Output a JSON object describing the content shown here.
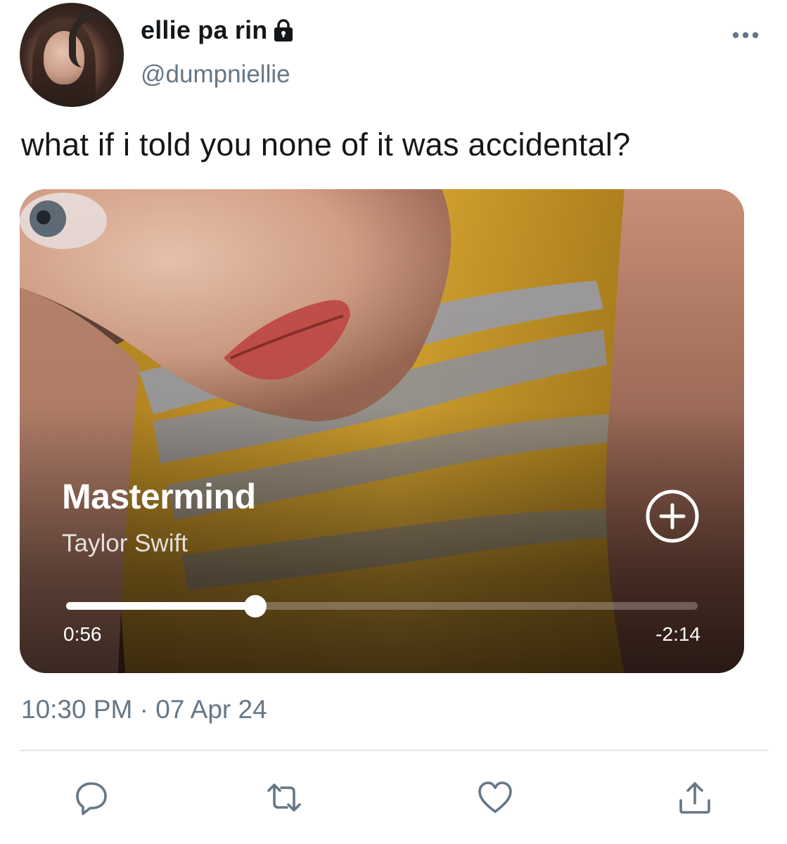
{
  "user": {
    "display_name": "ellie pa rin",
    "handle": "@dumpniellie",
    "protected_icon": "lock-icon",
    "avatar_icon": "avatar"
  },
  "tweet": {
    "text": "what if i told you none of it was accidental?",
    "timestamp": "10:30 PM · 07 Apr 24"
  },
  "media_card": {
    "song_title": "Mastermind",
    "artist": "Taylor Swift",
    "elapsed": "0:56",
    "remaining": "-2:14",
    "progress_fraction": 0.3,
    "add_icon": "plus-circle-icon"
  },
  "actions": [
    {
      "name": "reply",
      "icon": "reply-icon"
    },
    {
      "name": "retweet",
      "icon": "retweet-icon"
    },
    {
      "name": "like",
      "icon": "heart-icon"
    },
    {
      "name": "share",
      "icon": "share-icon"
    }
  ],
  "colors": {
    "text_primary": "#14171a",
    "text_secondary": "#657786",
    "icon": "#657786",
    "divider": "#e1e8ed"
  }
}
